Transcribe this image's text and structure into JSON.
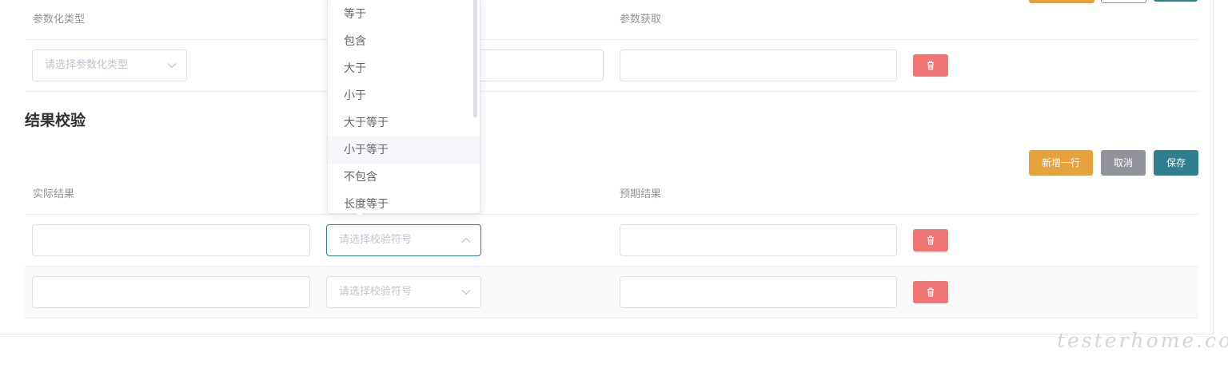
{
  "colors": {
    "accent": "#2f7f8f",
    "add": "#e6a23c",
    "cancel": "#909399",
    "delete": "#f07575"
  },
  "params_table": {
    "headers": [
      "参数化类型",
      "",
      "参数获取"
    ],
    "row": {
      "type_placeholder": "请选择参数化类型",
      "middle_value": "",
      "fetch_value": ""
    }
  },
  "result_check": {
    "title": "结果校验",
    "buttons": {
      "add": "新增一行",
      "cancel": "取消",
      "save": "保存"
    },
    "headers": [
      "实际结果",
      "",
      "预期结果"
    ],
    "rows": [
      {
        "actual": "",
        "operator_placeholder": "请选择校验符号",
        "expected": ""
      },
      {
        "actual": "",
        "operator_placeholder": "请选择校验符号",
        "expected": ""
      }
    ]
  },
  "dropdown": {
    "options": [
      "等于",
      "包含",
      "大于",
      "小于",
      "大于等于",
      "小于等于",
      "不包含",
      "长度等于"
    ],
    "hovered": "小于等于"
  },
  "icons": {
    "delete": "trash-icon",
    "select_arrow_down": "chevron-down-icon",
    "select_arrow_up": "chevron-up-icon"
  },
  "watermark": "testerhome.com"
}
